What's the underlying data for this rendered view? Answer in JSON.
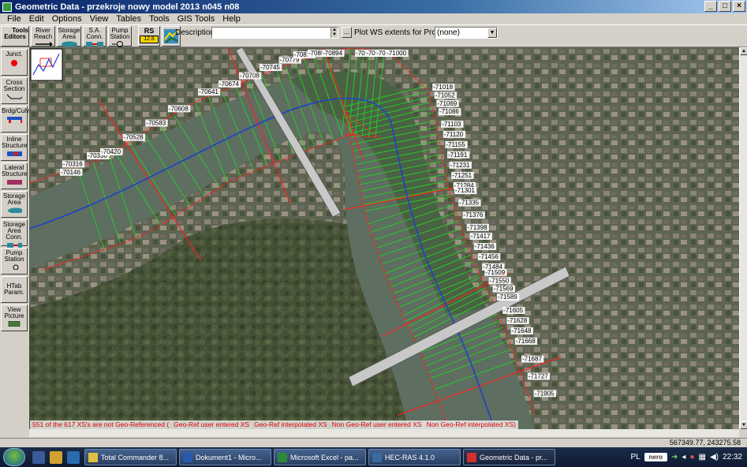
{
  "window": {
    "title": "Geometric Data - przekroje nowy model 2013 n045 n08",
    "btn_min": "_",
    "btn_max": "□",
    "btn_close": "×"
  },
  "menu": [
    "File",
    "Edit",
    "Options",
    "View",
    "Tables",
    "Tools",
    "GIS Tools",
    "Help"
  ],
  "toolbar": {
    "tools_label": "Tools",
    "editors_label": "Editors",
    "river_reach": "River Reach",
    "storage_area": "Storage Area",
    "sa_conn": "S.A. Conn.",
    "pump_station": "Pump Station",
    "rs_label": "RS",
    "rs_value": "12.8",
    "description_label": "Description :",
    "description_value": "",
    "dots_label": "...",
    "plot_ws_label": "Plot WS extents for Profile:",
    "profile_value": "(none)"
  },
  "sidebar": [
    {
      "id": "junct",
      "label": "Junct."
    },
    {
      "id": "cross-section",
      "label": "Cross Section"
    },
    {
      "id": "brdg-culv",
      "label": "Brdg/Culv"
    },
    {
      "id": "inline-structure",
      "label": "Inline Structure"
    },
    {
      "id": "lateral-structure",
      "label": "Lateral Structure"
    },
    {
      "id": "storage-area",
      "label": "Storage Area"
    },
    {
      "id": "storage-area-conn",
      "label": "Storage Area Conn."
    },
    {
      "id": "pump-station",
      "label": "Pump Station"
    },
    {
      "id": "htab-param",
      "label": "HTab Param."
    },
    {
      "id": "view-picture",
      "label": "View Picture"
    }
  ],
  "xs_labels": [
    "-70146",
    "-70316",
    "-70330",
    "-70420",
    "-70528",
    "-70583",
    "-70608",
    "-70641",
    "-70674",
    "-70708",
    "-70745",
    "-70779",
    "-70815",
    "-70856",
    "-70894",
    "-70946",
    "-70964",
    "-70982",
    "-71000",
    "-71018",
    "-71052",
    "-71069",
    "-71086",
    "-71103",
    "-71120",
    "-71155",
    "-71191",
    "-71231",
    "-71251",
    "-71284",
    "-71301",
    "-71335",
    "-71376",
    "-71398",
    "-71417",
    "-71436",
    "-71456",
    "-71484",
    "-71509",
    "-71550",
    "-71569",
    "-71589",
    "-71605",
    "-71628",
    "-71648",
    "-71668",
    "-71687",
    "-71727",
    "-71905"
  ],
  "legend": [
    "551 of the 617 XS's are not Geo-Referenced (",
    "Geo-Ref user entered XS",
    "Geo-Ref interpolated XS",
    "Non Geo-Ref user entered XS",
    "Non Geo-Ref interpolated XS)"
  ],
  "status": {
    "coordinates": "567349.77, 243275.58"
  },
  "taskbar": {
    "items": [
      "Total Commander 8...",
      "Dokument1 - Micro...",
      "Microsoft Excel - pa...",
      "HEC-RAS 4.1.0",
      "Geometric Data - pr..."
    ],
    "lang": "PL",
    "nero": "nero",
    "clock": "22:32"
  },
  "colors": {
    "user_xs": "#ff2020",
    "interp_xs": "#26d126",
    "bridge": "#c8c8c8",
    "river_line": "#1a3fd0"
  }
}
